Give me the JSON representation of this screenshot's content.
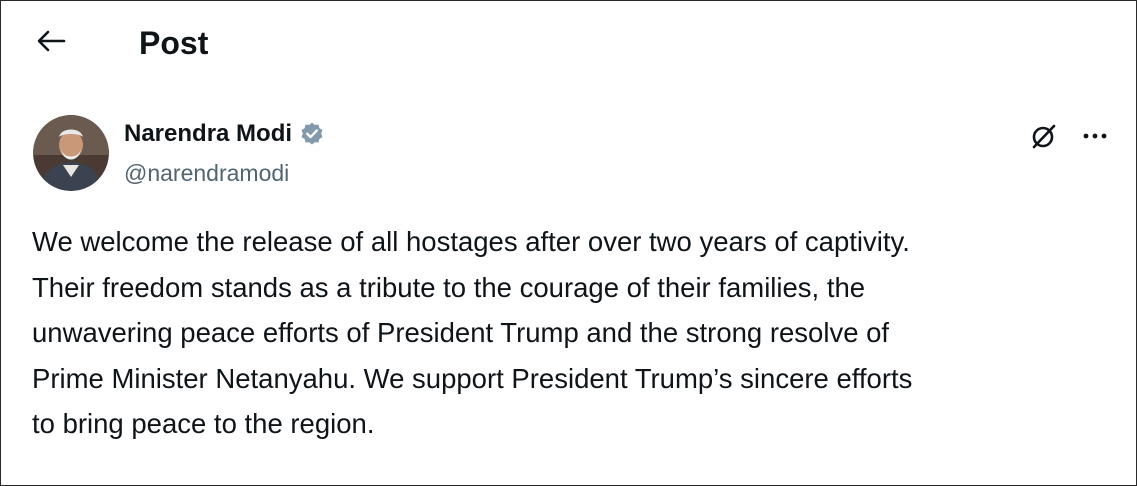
{
  "header": {
    "back_icon": "arrow-left-icon",
    "title": "Post"
  },
  "post": {
    "author": {
      "name": "Narendra Modi",
      "handle": "@narendramodi",
      "verified_icon": "verified-badge-icon",
      "verified_color": "#829aab",
      "avatar": "avatar"
    },
    "actions": {
      "grok_icon": "grok-icon",
      "more_icon": "more-horizontal-icon"
    },
    "text_lines": [
      "We welcome the release of all hostages after over two years of captivity.",
      "Their freedom stands as a tribute to the courage of their families, the",
      "unwavering peace efforts of President Trump and the strong resolve of",
      "Prime Minister Netanyahu. We support President Trump’s sincere efforts",
      "to bring peace to the region."
    ]
  },
  "colors": {
    "text_primary": "#0f1419",
    "text_secondary": "#536471",
    "border": "#2a2a2a"
  }
}
